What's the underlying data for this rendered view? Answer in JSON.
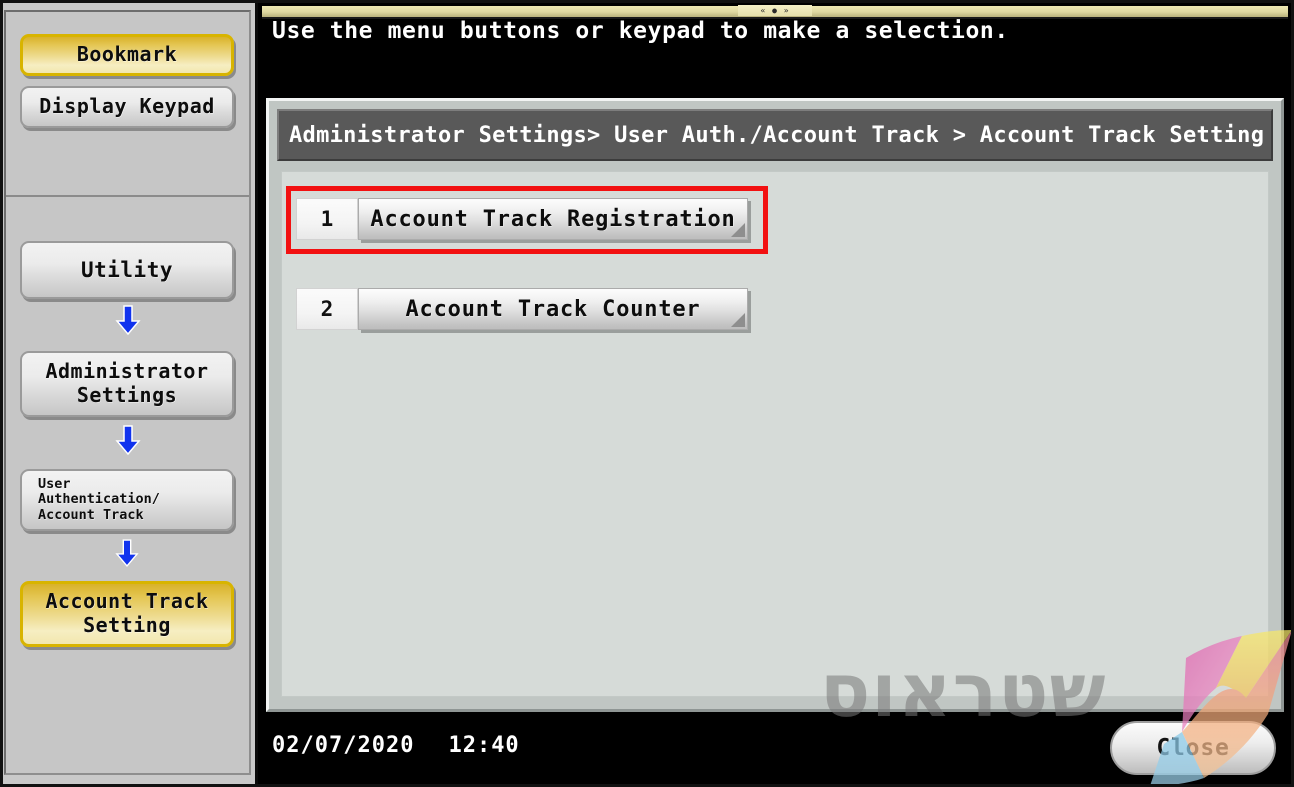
{
  "sidebar": {
    "groups": [
      {
        "name": "quick-access",
        "items": [
          {
            "label": "Bookmark",
            "highlighted": true
          },
          {
            "label": "Display Keypad",
            "highlighted": false
          }
        ]
      },
      {
        "name": "navigation-path",
        "items": [
          {
            "label": "Utility",
            "highlighted": false
          },
          {
            "label": "Administrator\nSettings",
            "highlighted": false
          },
          {
            "label": "User\nAuthentication/\nAccount Track",
            "highlighted": false
          },
          {
            "label": "Account Track\nSetting",
            "highlighted": true
          }
        ]
      }
    ],
    "utility_label": "Utility",
    "admin_label_line1": "Administrator",
    "admin_label_line2": "Settings",
    "userauth_line1": "User",
    "userauth_line2": "Authentication/",
    "userauth_line3": "Account Track",
    "acct_line1": "Account Track",
    "acct_line2": "Setting",
    "bookmark_label": "Bookmark",
    "keypad_label": "Display Keypad",
    "arrow_icon": "arrow-down-icon"
  },
  "header": {
    "prompt": "Use the menu buttons or keypad to make a selection.",
    "top_strip_marker": "« ● »"
  },
  "breadcrumb": {
    "text": "Administrator Settings> User Auth./Account Track > Account Track Setting"
  },
  "menu": {
    "items": [
      {
        "number": "1",
        "label": "Account Track Registration",
        "highlighted": true
      },
      {
        "number": "2",
        "label": "Account Track Counter",
        "highlighted": false
      }
    ]
  },
  "footer": {
    "date": "02/07/2020",
    "time": "12:40",
    "close_label": "Close"
  },
  "watermark": {
    "text": "שטראוס",
    "logo": "ribbon-logo"
  },
  "colors": {
    "accent_gold": "#e4c653",
    "highlight_red": "#f21111",
    "panel_bg": "#d6dbd8",
    "breadcrumb_bg": "#595959",
    "sidebar_bg": "#c6c6c6",
    "arrow_blue": "#1133ee"
  }
}
